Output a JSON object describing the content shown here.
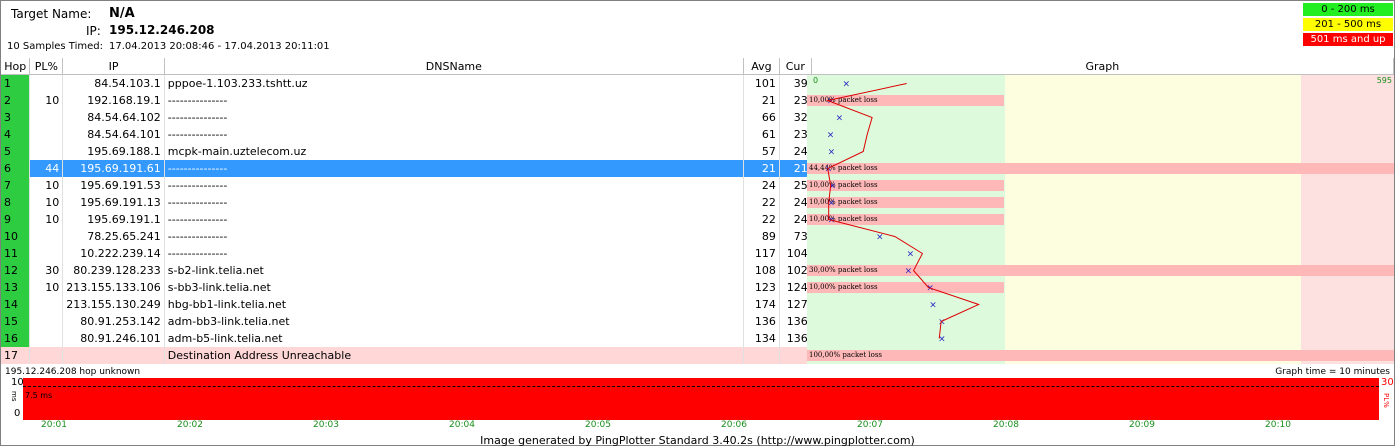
{
  "header": {
    "target_label": "Target Name:",
    "target_value": "N/A",
    "ip_label": "IP:",
    "ip_value": "195.12.246.208",
    "samples_label": "10 Samples Timed:",
    "samples_value": "17.04.2013 20:08:46 - 17.04.2013 20:11:01"
  },
  "legend": {
    "green": "0 - 200 ms",
    "yellow": "201 - 500 ms",
    "red": "501 ms and up",
    "green_color": "#22ee22",
    "yellow_color": "#ffff00",
    "red_color": "#ff0000"
  },
  "columns": [
    "Hop",
    "PL%",
    "IP",
    "DNSName",
    "Avg",
    "Cur",
    "Graph"
  ],
  "rows": [
    {
      "hop": "1",
      "pl": "",
      "ip": "84.54.103.1",
      "dns": "pppoe-1.103.233.tshtt.uz",
      "avg": "101",
      "cur": "39"
    },
    {
      "hop": "2",
      "pl": "10",
      "ip": "192.168.19.1",
      "dns": "---------------",
      "avg": "21",
      "cur": "23"
    },
    {
      "hop": "3",
      "pl": "",
      "ip": "84.54.64.102",
      "dns": "---------------",
      "avg": "66",
      "cur": "32"
    },
    {
      "hop": "4",
      "pl": "",
      "ip": "84.54.64.101",
      "dns": "---------------",
      "avg": "61",
      "cur": "23"
    },
    {
      "hop": "5",
      "pl": "",
      "ip": "195.69.188.1",
      "dns": "mcpk-main.uztelecom.uz",
      "avg": "57",
      "cur": "24"
    },
    {
      "hop": "6",
      "pl": "44",
      "ip": "195.69.191.61",
      "dns": "---------------",
      "avg": "21",
      "cur": "21"
    },
    {
      "hop": "7",
      "pl": "10",
      "ip": "195.69.191.53",
      "dns": "---------------",
      "avg": "24",
      "cur": "25"
    },
    {
      "hop": "8",
      "pl": "10",
      "ip": "195.69.191.13",
      "dns": "---------------",
      "avg": "22",
      "cur": "24"
    },
    {
      "hop": "9",
      "pl": "10",
      "ip": "195.69.191.1",
      "dns": "---------------",
      "avg": "22",
      "cur": "24"
    },
    {
      "hop": "10",
      "pl": "",
      "ip": "78.25.65.241",
      "dns": "---------------",
      "avg": "89",
      "cur": "73"
    },
    {
      "hop": "11",
      "pl": "",
      "ip": "10.222.239.14",
      "dns": "---------------",
      "avg": "117",
      "cur": "104"
    },
    {
      "hop": "12",
      "pl": "30",
      "ip": "80.239.128.233",
      "dns": "s-b2-link.telia.net",
      "avg": "108",
      "cur": "102"
    },
    {
      "hop": "13",
      "pl": "10",
      "ip": "213.155.133.106",
      "dns": "s-bb3-link.telia.net",
      "avg": "123",
      "cur": "124"
    },
    {
      "hop": "14",
      "pl": "",
      "ip": "213.155.130.249",
      "dns": "hbg-bb1-link.telia.net",
      "avg": "174",
      "cur": "127"
    },
    {
      "hop": "15",
      "pl": "",
      "ip": "80.91.253.142",
      "dns": "adm-bb3-link.telia.net",
      "avg": "136",
      "cur": "136"
    },
    {
      "hop": "16",
      "pl": "",
      "ip": "80.91.246.101",
      "dns": "adm-b5-link.telia.net",
      "avg": "134",
      "cur": "136"
    },
    {
      "hop": "17",
      "pl": "",
      "ip": "",
      "dns": "Destination Address Unreachable",
      "avg": "",
      "cur": ""
    }
  ],
  "graph": {
    "axis_start": "0",
    "axis_end": "595",
    "loss_labels": {
      "2": "10,00% packet loss",
      "6": "44,44% packet loss",
      "7": "10,00% packet loss",
      "8": "10,00% packet loss",
      "9": "10,00% packet loss",
      "12": "30,00% packet loss",
      "13": "10,00% packet loss",
      "17": "100,00% packet loss"
    }
  },
  "bottom": {
    "left_title": "195.12.246.208 hop unknown",
    "right_title": "Graph time = 10 minutes",
    "y_top": "10",
    "y_zero": "0",
    "y_unit": "ms",
    "right_top": "30",
    "right_unit": "PL%",
    "latency_label": "7.5 ms",
    "x_ticks": [
      "20:01",
      "20:02",
      "20:03",
      "20:04",
      "20:05",
      "20:06",
      "20:07",
      "20:08",
      "20:09",
      "20:10"
    ],
    "footer": "Image generated by PingPlotter Standard 3.40.2s (http://www.pingplotter.com)"
  }
}
